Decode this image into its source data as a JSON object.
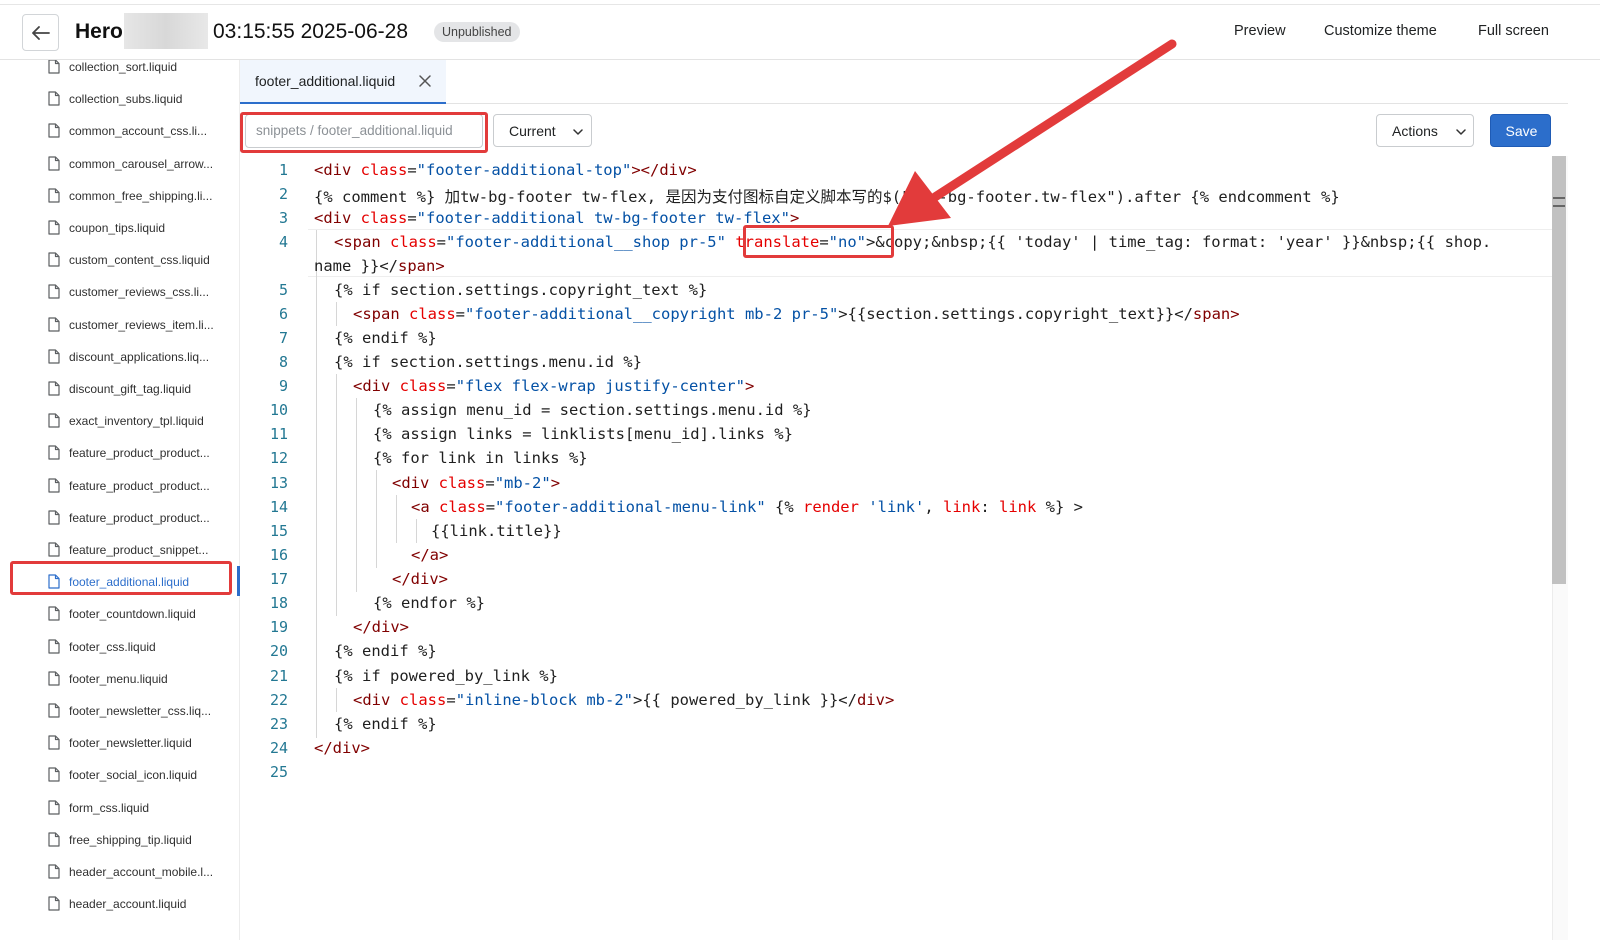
{
  "header": {
    "theme_name": "Hero",
    "theme_date": "03:15:55 2025-06-28",
    "status_badge": "Unpublished",
    "preview_label": "Preview",
    "customize_label": "Customize theme",
    "fullscreen_label": "Full screen"
  },
  "sidebar": {
    "files": [
      "collection_sort.liquid",
      "collection_subs.liquid",
      "common_account_css.li...",
      "common_carousel_arrow...",
      "common_free_shipping.li...",
      "coupon_tips.liquid",
      "custom_content_css.liquid",
      "customer_reviews_css.li...",
      "customer_reviews_item.li...",
      "discount_applications.liq...",
      "discount_gift_tag.liquid",
      "exact_inventory_tpl.liquid",
      "feature_product_product...",
      "feature_product_product...",
      "feature_product_product...",
      "feature_product_snippet...",
      "footer_additional.liquid",
      "footer_countdown.liquid",
      "footer_css.liquid",
      "footer_menu.liquid",
      "footer_newsletter_css.liq...",
      "footer_newsletter.liquid",
      "footer_social_icon.liquid",
      "form_css.liquid",
      "free_shipping_tip.liquid",
      "header_account_mobile.l...",
      "header_account.liquid"
    ],
    "active_file": "footer_additional.liquid"
  },
  "editor": {
    "tab_label": "footer_additional.liquid",
    "file_path": "snippets / footer_additional.liquid",
    "version_select": "Current",
    "actions_label": "Actions",
    "save_label": "Save",
    "line_numbers": [
      "1",
      "2",
      "3",
      "4",
      "5",
      "6",
      "7",
      "8",
      "9",
      "10",
      "11",
      "12",
      "13",
      "14",
      "15",
      "16",
      "17",
      "18",
      "19",
      "20",
      "21",
      "22",
      "23",
      "24",
      "25"
    ],
    "code": {
      "l1_open": "<div",
      "l1_attr": " class",
      "l1_eq": "=",
      "l1_str": "\"footer-additional-top\"",
      "l1_close": "></",
      "l1_tag": "div",
      "l1_end": ">",
      "l2": "{% comment %} 加tw-bg-footer tw-flex, 是因为支付图标自定义脚本写的$(\".tw-bg-footer.tw-flex\").after {% endcomment %}",
      "l3_open": "<div",
      "l3_attr": " class",
      "l3_eq": "=",
      "l3_str": "\"footer-additional tw-bg-footer tw-flex\"",
      "l3_end": ">",
      "l4_lt": "<",
      "l4_tag": "span",
      "l4_attr": " class",
      "l4_eq": "=",
      "l4_str": "\"footer-additional__shop pr-5\"",
      "l4_sp": " ",
      "l4_tattr": "translate",
      "l4_teq": "=",
      "l4_tstr": "\"no\"",
      "l4_rest": ">&copy;&nbsp;{{ 'today' | time_tag: format: 'year' }}&nbsp;{{ shop.",
      "l4b_text": "name }}</",
      "l4b_tag": "span",
      "l4b_end": ">",
      "l5": "{% if section.settings.copyright_text %}",
      "l6_lt": "<",
      "l6_tag": "span",
      "l6_attr": " class",
      "l6_eq": "=",
      "l6_str": "\"footer-additional__copyright mb-2 pr-5\"",
      "l6_text": ">{{section.settings.copyright_text}}</",
      "l6_ctag": "span",
      "l6_end": ">",
      "l7": "{% endif %}",
      "l8": "{% if section.settings.menu.id %}",
      "l9_lt": "<",
      "l9_tag": "div",
      "l9_attr": " class",
      "l9_eq": "=",
      "l9_str": "\"flex flex-wrap justify-center\"",
      "l9_end": ">",
      "l10": "{% assign menu_id = section.settings.menu.id %}",
      "l11": "{% assign links = linklists[menu_id].links %}",
      "l12": "{% for link in links %}",
      "l13_lt": "<",
      "l13_tag": "div",
      "l13_attr": " class",
      "l13_eq": "=",
      "l13_str": "\"mb-2\"",
      "l13_end": ">",
      "l14_lt": "<",
      "l14_tag": "a",
      "l14_attr": " class",
      "l14_eq": "=",
      "l14_str": "\"footer-additional-menu-link\"",
      "l14_p1": " {% ",
      "l14_kw1": "render",
      "l14_s1": " 'link'",
      "l14_p2": ", ",
      "l14_kw2": "link",
      "l14_p3": ": ",
      "l14_kw3": "link",
      "l14_p4": " %} >",
      "l15": "{{link.title}}",
      "l16_lt": "</",
      "l16_tag": "a",
      "l16_end": ">",
      "l17_lt": "</",
      "l17_tag": "div",
      "l17_end": ">",
      "l18": "{% endfor %}",
      "l19_lt": "</",
      "l19_tag": "div",
      "l19_end": ">",
      "l20": "{% endif %}",
      "l21": "{% if powered_by_link %}",
      "l22_lt": "<",
      "l22_tag": "div",
      "l22_attr": " class",
      "l22_eq": "=",
      "l22_str": "\"inline-block mb-2\"",
      "l22_text": ">{{ powered_by_link }}</",
      "l22_ctag": "div",
      "l22_end": ">",
      "l23": "{% endif %}",
      "l24_lt": "</",
      "l24_tag": "div",
      "l24_end": ">"
    }
  },
  "colors": {
    "accent": "#2c6ecb",
    "annotation": "#e23b3b"
  }
}
